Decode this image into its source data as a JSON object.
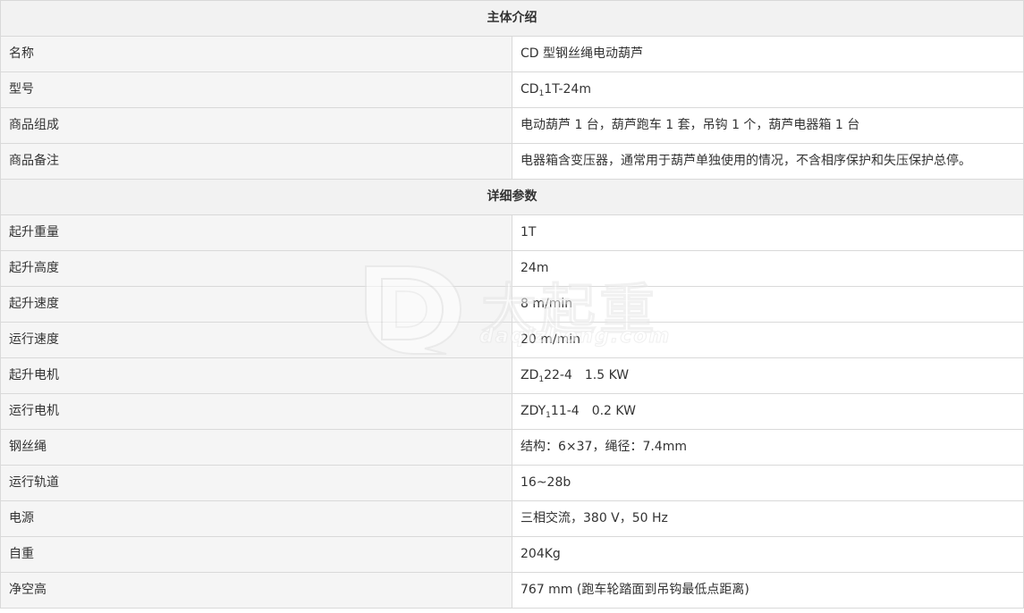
{
  "sections": {
    "intro_title": "主体介绍",
    "detail_title": "详细参数"
  },
  "intro": {
    "name_label": "名称",
    "name_value": "CD 型钢丝绳电动葫芦",
    "model_label": "型号",
    "model_value": {
      "prefix": "CD",
      "sub": "1",
      "suffix": "1T-24m"
    },
    "composition_label": "商品组成",
    "composition_value": "电动葫芦 1 台，葫芦跑车 1 套，吊钩 1 个，葫芦电器箱 1 台",
    "remark_label": "商品备注",
    "remark_value": "电器箱含变压器，通常用于葫芦单独使用的情况，不含相序保护和失压保护总停。"
  },
  "details": {
    "lift_weight_label": "起升重量",
    "lift_weight_value": "1T",
    "lift_height_label": "起升高度",
    "lift_height_value": "24m",
    "lift_speed_label": "起升速度",
    "lift_speed_value": "8 m/min",
    "run_speed_label": "运行速度",
    "run_speed_value": "20 m/min",
    "lift_motor_label": "起升电机",
    "lift_motor_value": {
      "prefix": "ZD",
      "sub": "1",
      "suffix": "22-4",
      "power": "1.5 KW"
    },
    "run_motor_label": "运行电机",
    "run_motor_value": {
      "prefix": "ZDY",
      "sub": "1",
      "suffix": "11-4",
      "power": "0.2 KW"
    },
    "rope_label": "钢丝绳",
    "rope_value": "结构：6×37，绳径：7.4mm",
    "track_label": "运行轨道",
    "track_value": "16~28b",
    "power_label": "电源",
    "power_value": "三相交流，380 V，50 Hz",
    "self_weight_label": "自重",
    "self_weight_value": "204Kg",
    "clearance_label": "净空高",
    "clearance_value": "767 mm (跑车轮踏面到吊钩最低点距离)"
  },
  "watermark": {
    "title": "大起重",
    "domain": "daqizhong.com",
    "logo_icon": "dq-logo-icon"
  }
}
